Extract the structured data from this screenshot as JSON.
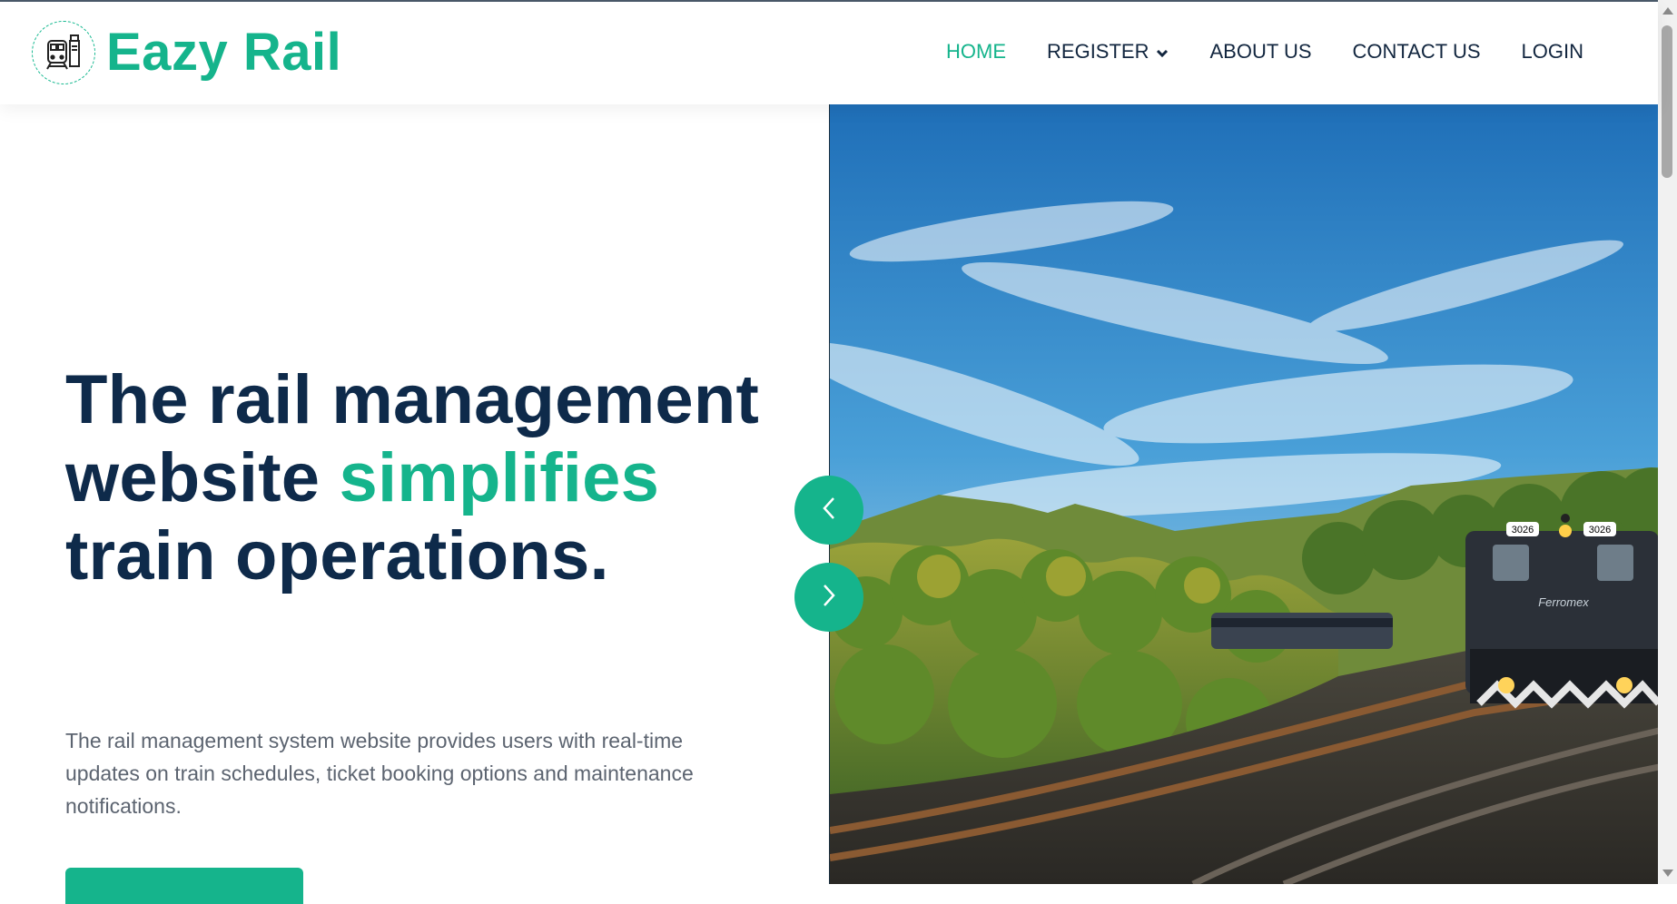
{
  "brand": {
    "name": "Eazy Rail",
    "logo_icon": "train-icon",
    "accent_color": "#15b48c",
    "heading_color": "#0e2a4a"
  },
  "nav": {
    "items": [
      {
        "label": "HOME",
        "active": true
      },
      {
        "label": "REGISTER",
        "has_dropdown": true
      },
      {
        "label": "ABOUT US"
      },
      {
        "label": "CONTACT US"
      },
      {
        "label": "LOGIN"
      }
    ]
  },
  "hero": {
    "title_line1": "The rail management",
    "title_line2_prefix": "website ",
    "title_highlight": "simplifies",
    "title_line3": "train operations.",
    "description": "The rail management system website provides users with real-time updates on train schedules, ticket booking options and maintenance notifications.",
    "image_alt": "Ferromex locomotive 3026 on curved track through forested hills"
  },
  "train_photo": {
    "loco_number": "3026",
    "loco_brand": "Ferromex"
  },
  "carousel": {
    "prev_icon": "chevron-left-icon",
    "next_icon": "chevron-right-icon"
  }
}
